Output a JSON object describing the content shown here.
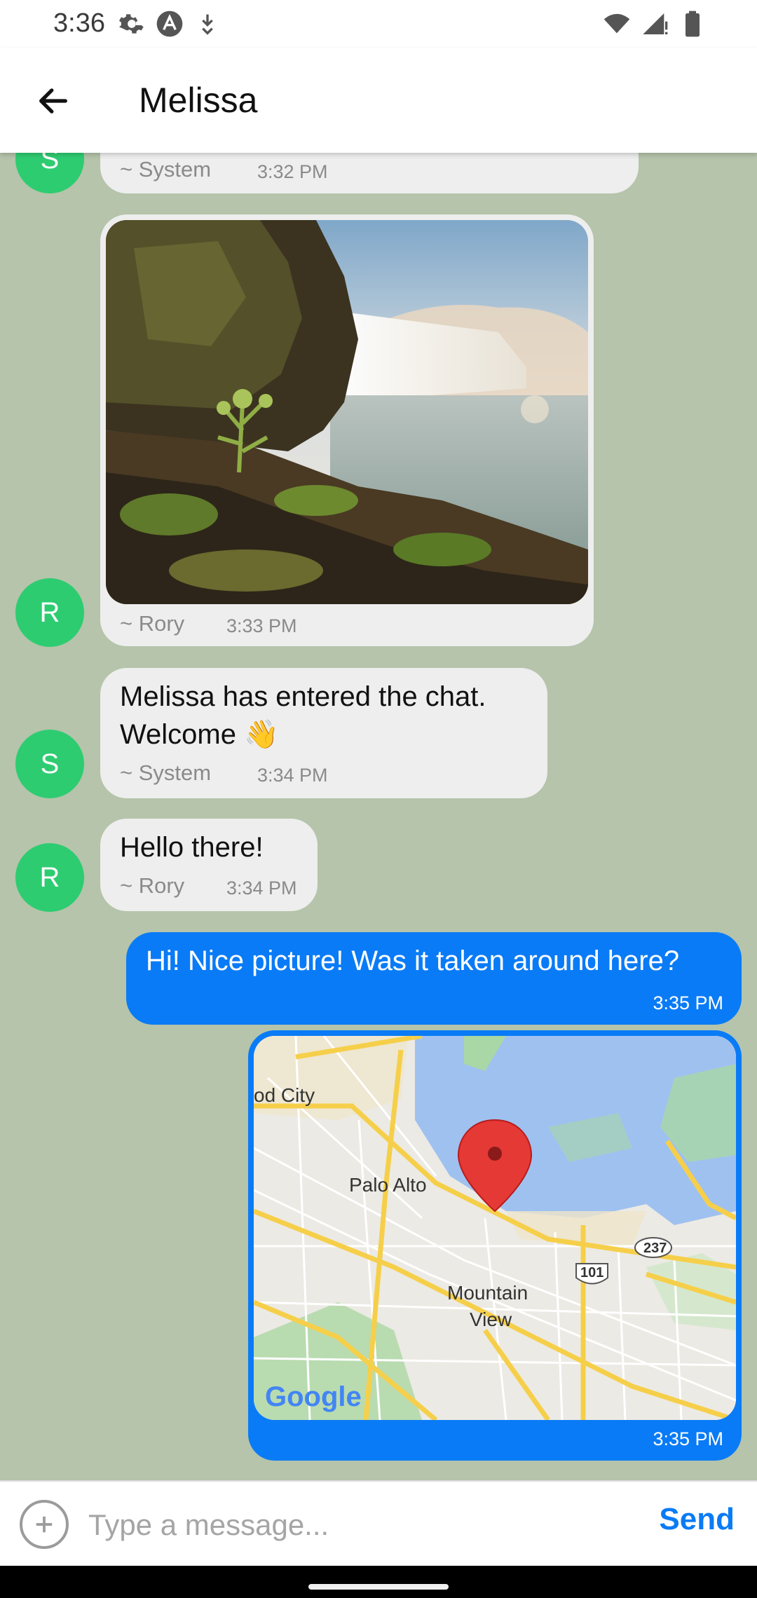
{
  "status_bar": {
    "time": "3:36",
    "left_icons": [
      "settings-icon",
      "app-badge-icon",
      "download-icon"
    ],
    "right_icons": [
      "wifi-icon",
      "signal-icon",
      "battery-icon"
    ]
  },
  "header": {
    "back_icon": "arrow-left-icon",
    "title": "Melissa"
  },
  "messages": [
    {
      "type": "text",
      "direction": "incoming",
      "avatar": "S",
      "sender": "~ System",
      "time": "3:32 PM",
      "partially_visible": true
    },
    {
      "type": "image",
      "direction": "incoming",
      "avatar": "R",
      "sender": "~ Rory",
      "time": "3:33 PM"
    },
    {
      "type": "text",
      "direction": "incoming",
      "avatar": "S",
      "text_line1": "Melissa has entered the chat.",
      "text_line2": "Welcome 👋",
      "sender": "~ System",
      "time": "3:34 PM"
    },
    {
      "type": "text",
      "direction": "incoming",
      "avatar": "R",
      "text": "Hello there!",
      "sender": "~ Rory",
      "time": "3:34 PM"
    },
    {
      "type": "text",
      "direction": "outgoing",
      "text": "Hi! Nice picture! Was it taken around here?",
      "time": "3:35 PM"
    },
    {
      "type": "location",
      "direction": "outgoing",
      "map_labels": {
        "city1": "od City",
        "city2": "Palo Alto",
        "city3_line1": "Mountain",
        "city3_line2": "View",
        "highway1": "101",
        "highway2": "237",
        "brand": "Google"
      },
      "time": "3:35 PM"
    }
  ],
  "composer": {
    "attach_icon": "plus-circle-icon",
    "placeholder": "Type a message...",
    "send_label": "Send"
  },
  "colors": {
    "chat_background": "#b5c4aa",
    "incoming_bubble": "#eeeeee",
    "outgoing_bubble": "#0a7bf6",
    "avatar": "#2ecc71",
    "send": "#0a7bf6"
  }
}
